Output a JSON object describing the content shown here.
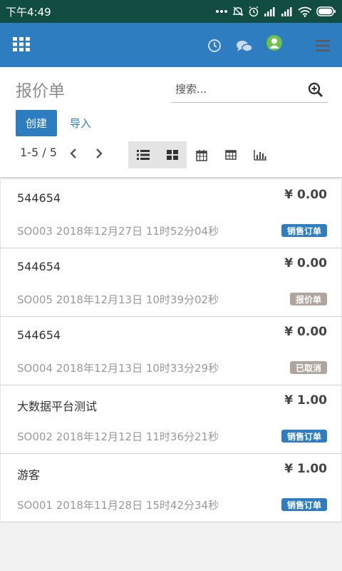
{
  "status_bar": {
    "time": "下午4:49"
  },
  "page": {
    "title": "报价单"
  },
  "search": {
    "placeholder": "搜索..."
  },
  "buttons": {
    "create": "创建",
    "import": "导入"
  },
  "pager": {
    "text": "1-5 / 5"
  },
  "colors": {
    "primary": "#2f7dc1",
    "status_bar": "#114d40",
    "badge_sale": "#2f7dc1",
    "badge_neutral": "#b0a59d"
  },
  "records": [
    {
      "customer": "544654",
      "amount": "¥ 0.00",
      "meta": "SO003 2018年12月27日 11时52分04秒",
      "state": "销售订单",
      "state_color": "#2f7dc1"
    },
    {
      "customer": "544654",
      "amount": "¥ 0.00",
      "meta": "SO005 2018年12月13日 10时39分02秒",
      "state": "报价单",
      "state_color": "#b0a59d"
    },
    {
      "customer": "544654",
      "amount": "¥ 0.00",
      "meta": "SO004 2018年12月13日 10时33分29秒",
      "state": "已取消",
      "state_color": "#b0a59d"
    },
    {
      "customer": "大数据平台测试",
      "amount": "¥ 1.00",
      "meta": "SO002 2018年12月12日 11时36分21秒",
      "state": "销售订单",
      "state_color": "#2f7dc1"
    },
    {
      "customer": "游客",
      "amount": "¥ 1.00",
      "meta": "SO001 2018年11月28日 15时42分34秒",
      "state": "销售订单",
      "state_color": "#2f7dc1"
    }
  ]
}
